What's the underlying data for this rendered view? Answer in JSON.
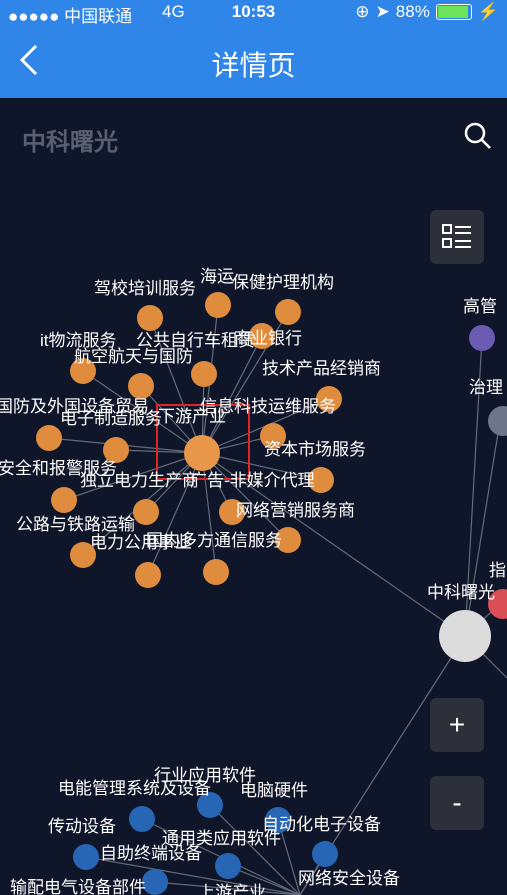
{
  "status_bar": {
    "signal": "●●●●● 中国联通",
    "network": "4G",
    "time": "10:53",
    "battery": "88%"
  },
  "navbar": {
    "title": "详情页",
    "back_icon": "chevron-left-icon"
  },
  "header": {
    "company": "中科曙光",
    "search_icon": "search-icon"
  },
  "controls": {
    "list_icon": "list-icon",
    "zoom_in": "+",
    "zoom_out": "-"
  },
  "colors": {
    "nav": "#2f86e8",
    "orange": "#e08c3e",
    "blue": "#2766b5",
    "purple": "#6b5bb3",
    "red": "#d94f55"
  },
  "graph": {
    "center_label": "中科曙光",
    "hub_label": "下游产业",
    "orange_labels": [
      "驾校培训服务",
      "海运",
      "保健护理机构",
      "商业银行",
      "it物流服务",
      "公共自行车租赁",
      "航空航天与国防",
      "技术产品经销商",
      "国防及外国设备贸易",
      "电子制造服务",
      "信息科技运维服务",
      "安全和报警服务",
      "独立电力生产商",
      "资本市场服务",
      "广告-非媒介代理",
      "公路与铁路运输",
      "网络营销服务商",
      "电力公用事业",
      "国内多方通信服务"
    ],
    "right_labels": [
      "高管",
      "治理",
      "指"
    ],
    "blue_labels": [
      "行业应用软件",
      "电能管理系统及设备",
      "电脑硬件",
      "传动设备",
      "自动化电子设备",
      "通用类应用软件",
      "自助终端设备",
      "输配电气设备部件",
      "上游产业",
      "网络安全设备"
    ]
  }
}
